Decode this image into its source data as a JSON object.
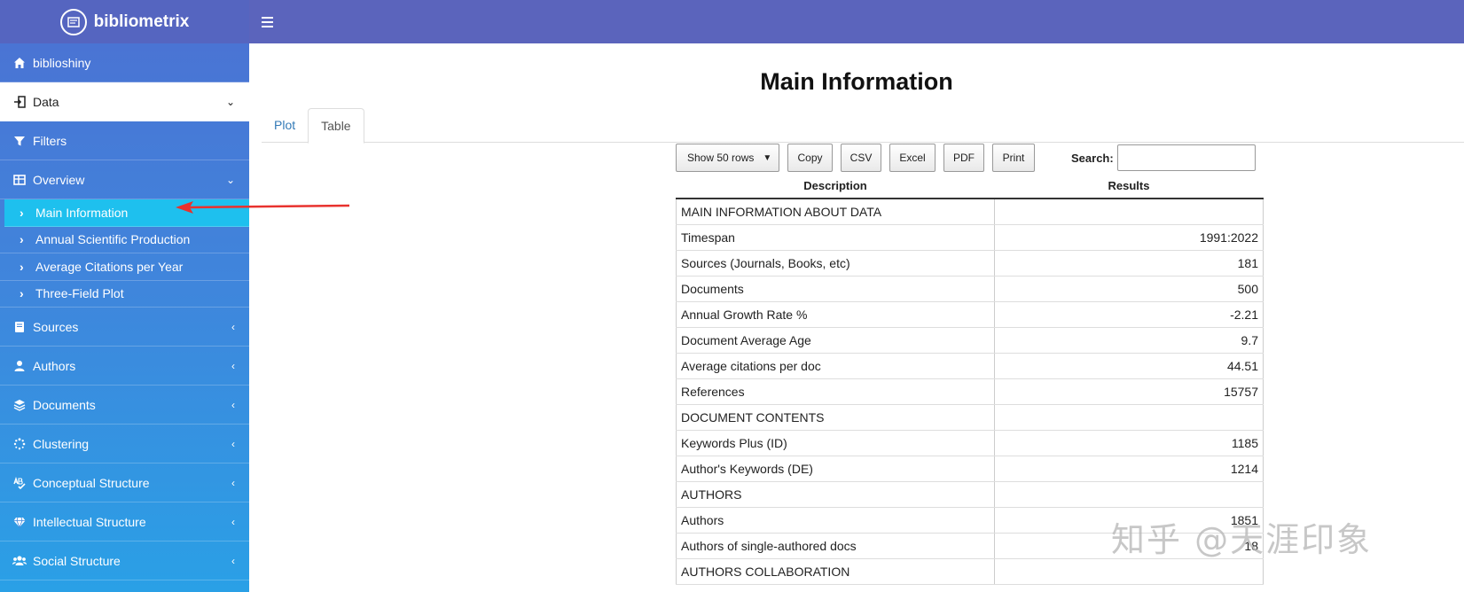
{
  "header": {
    "brand": "bibliometrix",
    "colors": {
      "brand_bg": "#5565c0",
      "navbar_bg": "#5b64bc",
      "active_item": "#1ec0ee"
    }
  },
  "sidebar": {
    "items": [
      {
        "label": "biblioshiny",
        "icon": "home-icon"
      },
      {
        "label": "Data",
        "icon": "import-icon"
      },
      {
        "label": "Filters",
        "icon": "filter-icon"
      },
      {
        "label": "Overview",
        "icon": "table-icon"
      },
      {
        "label": "Sources",
        "icon": "book-icon"
      },
      {
        "label": "Authors",
        "icon": "user-icon"
      },
      {
        "label": "Documents",
        "icon": "layers-icon"
      },
      {
        "label": "Clustering",
        "icon": "spinner-icon"
      },
      {
        "label": "Conceptual Structure",
        "icon": "spellcheck-icon"
      },
      {
        "label": "Intellectual Structure",
        "icon": "gem-icon"
      },
      {
        "label": "Social Structure",
        "icon": "users-icon"
      }
    ],
    "overview_sub": [
      {
        "label": "Main Information"
      },
      {
        "label": "Annual Scientific Production"
      },
      {
        "label": "Average Citations per Year"
      },
      {
        "label": "Three-Field Plot"
      }
    ]
  },
  "main": {
    "title": "Main Information",
    "tabs": [
      "Plot",
      "Table"
    ],
    "active_tab": "Table",
    "toolbar": {
      "length": "Show 50 rows",
      "copy": "Copy",
      "csv": "CSV",
      "excel": "Excel",
      "pdf": "PDF",
      "print": "Print",
      "search_label": "Search:"
    },
    "table": {
      "columns": [
        "Description",
        "Results"
      ],
      "rows": [
        [
          "MAIN INFORMATION ABOUT DATA",
          ""
        ],
        [
          "Timespan",
          "1991:2022"
        ],
        [
          "Sources (Journals, Books, etc)",
          "181"
        ],
        [
          "Documents",
          "500"
        ],
        [
          "Annual Growth Rate %",
          "-2.21"
        ],
        [
          "Document Average Age",
          "9.7"
        ],
        [
          "Average citations per doc",
          "44.51"
        ],
        [
          "References",
          "15757"
        ],
        [
          "DOCUMENT CONTENTS",
          ""
        ],
        [
          "Keywords Plus (ID)",
          "1185"
        ],
        [
          "Author's Keywords (DE)",
          "1214"
        ],
        [
          "AUTHORS",
          ""
        ],
        [
          "Authors",
          "1851"
        ],
        [
          "Authors of single-authored docs",
          "18"
        ],
        [
          "AUTHORS COLLABORATION",
          ""
        ]
      ]
    }
  },
  "watermark": "知乎 @天涯印象"
}
